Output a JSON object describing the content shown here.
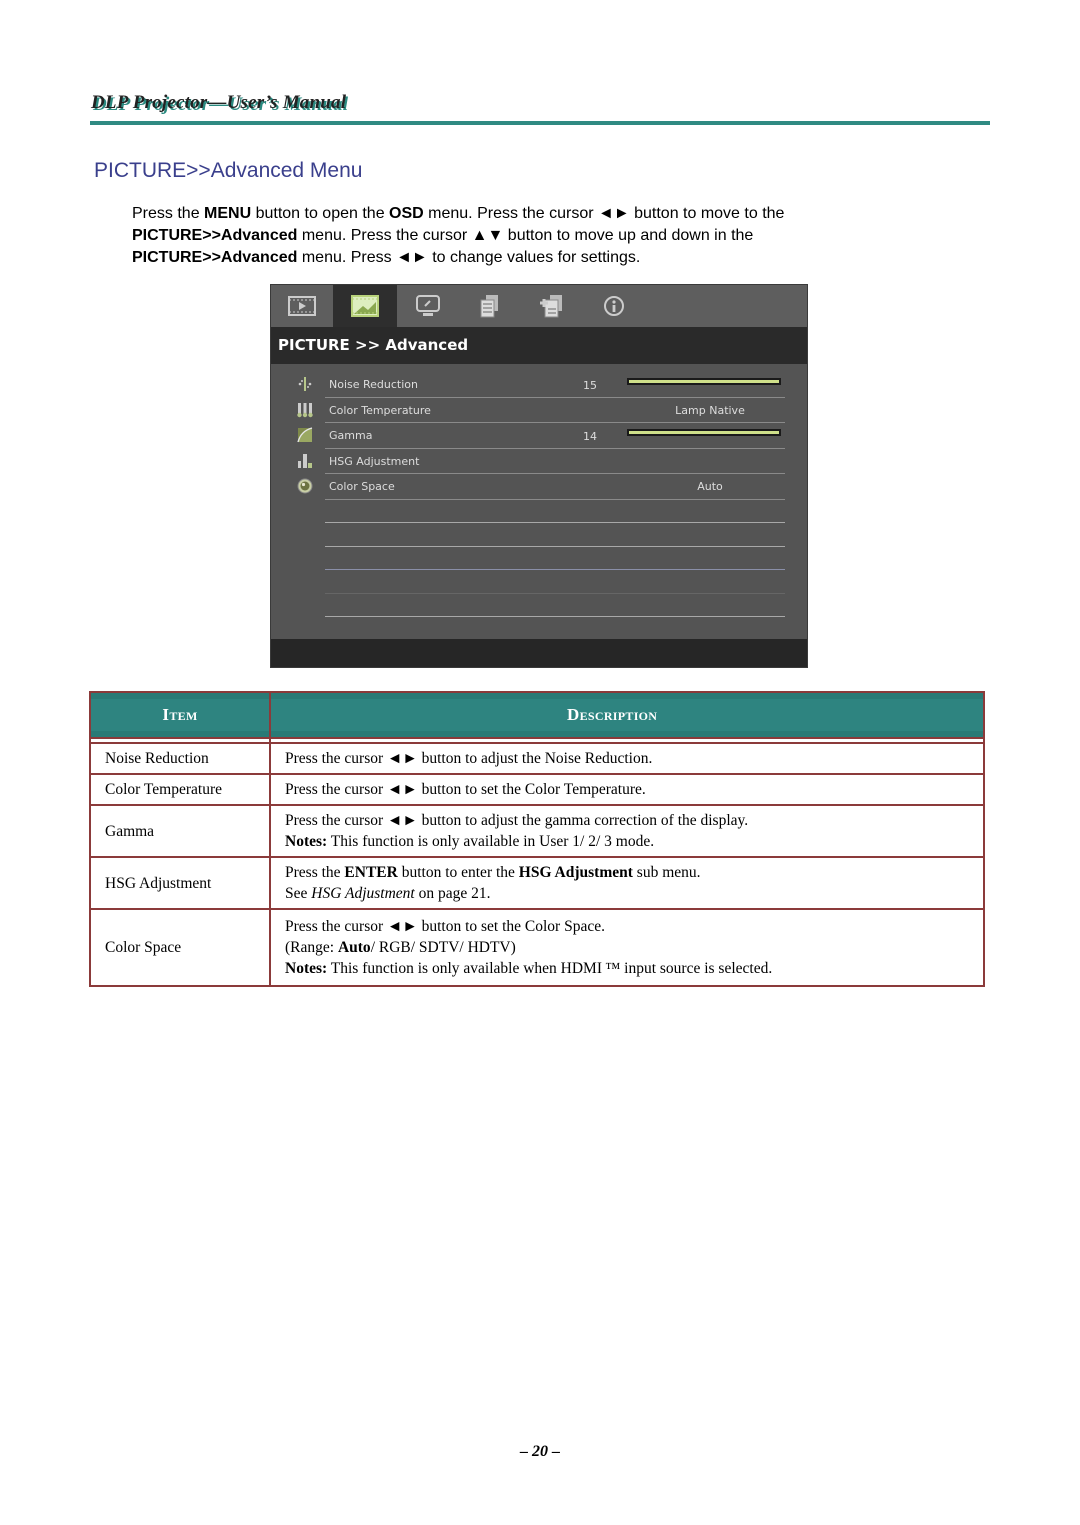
{
  "header": {
    "title": "DLP Projector—User’s Manual"
  },
  "section_title": "PICTURE>>Advanced Menu",
  "intro": {
    "line1": [
      "Press the ",
      "MENU",
      " button to open the ",
      "OSD",
      " menu. Press the cursor ◄► button to move to the"
    ],
    "line2": [
      "PICTURE>>Advanced",
      " menu. Press the cursor ▲▼ button to move up and down in the"
    ],
    "line3": [
      "PICTURE>>Advanced",
      " menu. Press ◄► to change values for settings."
    ]
  },
  "osd": {
    "tabs": [
      {
        "icon": "film-play-icon",
        "active": false
      },
      {
        "icon": "picture-icon",
        "active": true
      },
      {
        "icon": "display-icon",
        "active": false
      },
      {
        "icon": "settings-document-icon",
        "active": false
      },
      {
        "icon": "advanced-settings-icon",
        "active": false
      },
      {
        "icon": "info-icon",
        "active": false
      }
    ],
    "title": "PICTURE >> Advanced",
    "rows": [
      {
        "icon": "noise-reduction-icon",
        "label": "Noise Reduction",
        "number": "15",
        "slider_fraction": 1.0,
        "value": ""
      },
      {
        "icon": "color-temperature-icon",
        "label": "Color Temperature",
        "number": "",
        "slider_fraction": null,
        "value": "Lamp Native"
      },
      {
        "icon": "gamma-icon",
        "label": "Gamma",
        "number": "14",
        "slider_fraction": 1.0,
        "value": ""
      },
      {
        "icon": "hsg-adjustment-icon",
        "label": "HSG Adjustment",
        "number": "",
        "slider_fraction": null,
        "value": ""
      },
      {
        "icon": "color-space-icon",
        "label": "Color Space",
        "number": "",
        "slider_fraction": null,
        "value": "Auto"
      }
    ],
    "accent_color": "#cfe08a"
  },
  "table": {
    "headers": [
      "Item",
      "Description"
    ],
    "header_color": "#2e8480",
    "border_color": "#8b3a3a",
    "rows": [
      {
        "item": "Noise Reduction",
        "lines": [
          [
            "Press the cursor ◄► button to adjust the Noise Reduction."
          ]
        ]
      },
      {
        "item": "Color Temperature",
        "lines": [
          [
            "Press the cursor ◄► button to set the Color Temperature."
          ]
        ]
      },
      {
        "item": "Gamma",
        "lines": [
          [
            "Press the cursor ◄► button to adjust the gamma correction of the display."
          ],
          [
            "Notes:",
            " This function is only available in User 1/ 2/ 3 mode."
          ]
        ]
      },
      {
        "item": "HSG Adjustment",
        "lines": [
          [
            "Press the ",
            "ENTER",
            " button to enter the ",
            "HSG Adjustment",
            " sub menu."
          ],
          [
            "See ",
            "HSG Adjustment",
            " on page 21."
          ]
        ]
      },
      {
        "item": "Color Space",
        "lines": [
          [
            "Press the cursor ◄► button to set the Color Space."
          ],
          [
            "(Range: ",
            "Auto",
            "/ RGB/ SDTV/ HDTV)"
          ],
          [
            "Notes:",
            " This function is only available when HDMI ™ input source is selected."
          ]
        ]
      }
    ]
  },
  "page_number": "– 20 –"
}
